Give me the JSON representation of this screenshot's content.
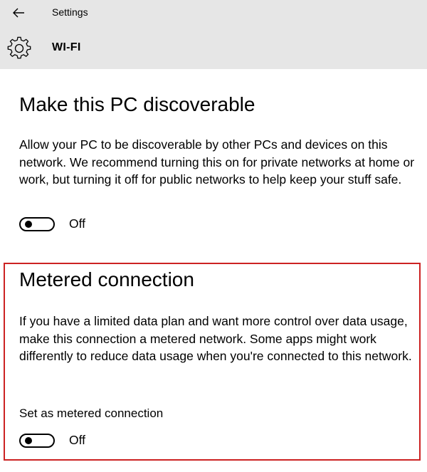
{
  "header": {
    "window_title": "Settings",
    "page_title": "WI-FI",
    "back_icon": "back-arrow-icon",
    "page_icon": "gear-icon",
    "background": "#e6e6e6"
  },
  "discoverable": {
    "title": "Make this PC discoverable",
    "description": "Allow your PC to be discoverable by other PCs and devices on this network. We recommend turning this on for private networks at home or work, but turning it off for public networks to help keep your stuff safe.",
    "toggle_state": "Off"
  },
  "metered": {
    "title": "Metered connection",
    "description": "If you have a limited data plan and want more control over data usage, make this connection a metered network. Some apps might work differently to reduce data usage when you're connected to this network.",
    "setting_label": "Set as metered connection",
    "toggle_state": "Off",
    "highlight_color": "#cc2222"
  }
}
